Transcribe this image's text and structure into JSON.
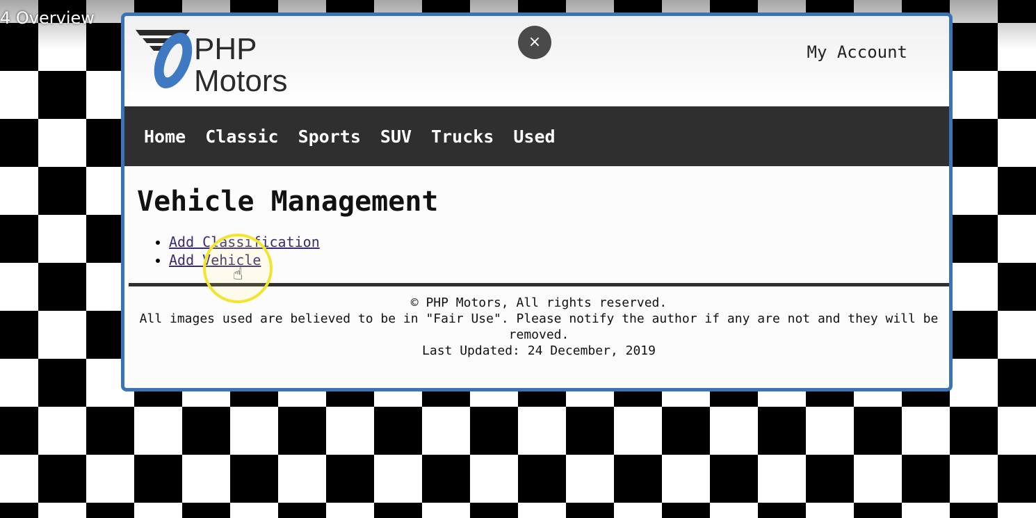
{
  "video": {
    "title": "4 Overview"
  },
  "modal": {
    "close_label": "×"
  },
  "header": {
    "logo_text_line1": "PHP",
    "logo_text_line2": "Motors",
    "account_label": "My Account"
  },
  "nav": {
    "items": [
      {
        "label": "Home"
      },
      {
        "label": "Classic"
      },
      {
        "label": "Sports"
      },
      {
        "label": "SUV"
      },
      {
        "label": "Trucks"
      },
      {
        "label": "Used"
      }
    ]
  },
  "main": {
    "title": "Vehicle Management",
    "links": [
      {
        "label": "Add Classification"
      },
      {
        "label": "Add Vehicle"
      }
    ]
  },
  "footer": {
    "copyright": "© PHP Motors, All rights reserved.",
    "fair_use": "All images used are believed to be in \"Fair Use\". Please notify the author if any are not and they will be removed.",
    "last_updated": "Last Updated: 24 December, 2019"
  },
  "colors": {
    "frame_border": "#3a73b6",
    "nav_background": "#2f2f2f",
    "logo_blue": "#3f79c1",
    "cursor_highlight": "#f2e530"
  },
  "icons": {
    "close": "close-icon",
    "cursor": "hand-pointer-icon"
  }
}
